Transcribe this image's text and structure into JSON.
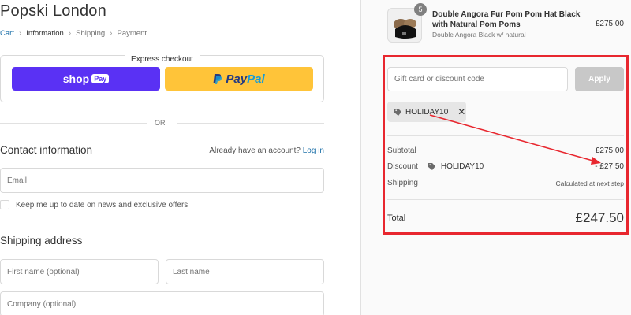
{
  "store": {
    "name": "Popski London"
  },
  "breadcrumb": {
    "items": [
      "Cart",
      "Information",
      "Shipping",
      "Payment"
    ]
  },
  "express": {
    "title": "Express checkout",
    "shop_label": "shop",
    "shop_badge": "Pay",
    "paypal_pay": "Pay",
    "paypal_pal": "Pal"
  },
  "divider": {
    "or": "OR"
  },
  "contact": {
    "heading": "Contact information",
    "account_prompt": "Already have an account?",
    "login_link": "Log in",
    "email_placeholder": "Email",
    "newsletter_label": "Keep me up to date on news and exclusive offers"
  },
  "shipping": {
    "heading": "Shipping address",
    "first_name_placeholder": "First name (optional)",
    "last_name_placeholder": "Last name",
    "company_placeholder": "Company (optional)"
  },
  "product": {
    "quantity": "5",
    "title": "Double Angora Fur Pom Pom Hat Black with Natural Pom Poms",
    "variant": "Double Angora Black w/ natural",
    "price": "£275.00"
  },
  "discount": {
    "placeholder": "Gift card or discount code",
    "apply_label": "Apply",
    "applied_code": "HOLIDAY10",
    "remove_symbol": "✕"
  },
  "summary": {
    "subtotal_label": "Subtotal",
    "subtotal_value": "£275.00",
    "discount_label": "Discount",
    "discount_code": "HOLIDAY10",
    "discount_value": "- £27.50",
    "shipping_label": "Shipping",
    "shipping_value": "Calculated at next step",
    "total_label": "Total",
    "total_value": "£247.50"
  },
  "colors": {
    "shop_pay": "#5a31f4",
    "paypal": "#ffc439",
    "link": "#1a6fa8",
    "annotation": "#e8272f"
  }
}
